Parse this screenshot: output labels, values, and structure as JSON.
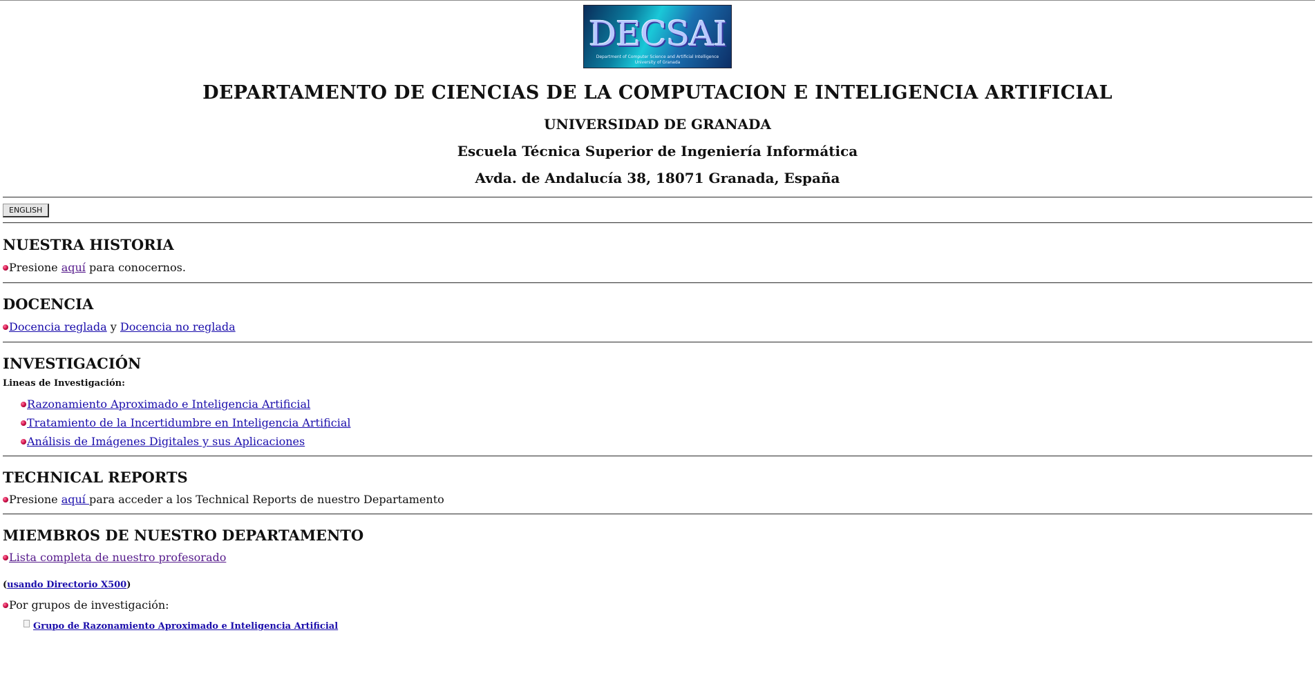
{
  "header": {
    "logo": {
      "word": "DECSAI",
      "sub1": "Department of Computer Science and Artificial Intelligence",
      "sub2": "University of Granada"
    },
    "title": "DEPARTAMENTO DE CIENCIAS DE LA COMPUTACION E INTELIGENCIA ARTIFICIAL",
    "university": "UNIVERSIDAD DE GRANADA",
    "school": "Escuela Técnica Superior de Ingeniería Informática",
    "address": "Avda. de Andalucía 38, 18071 Granada, España"
  },
  "lang_button": "ENGLISH",
  "historia": {
    "heading": "NUESTRA HISTORIA",
    "pre": "Presione",
    "link": "aquí",
    "post": " para conocernos."
  },
  "docencia": {
    "heading": "DOCENCIA",
    "link1": "Docencia reglada",
    "mid": " y ",
    "link2": "Docencia no reglada"
  },
  "investigacion": {
    "heading": "INVESTIGACIÓN",
    "label": "Lineas de Investigación:",
    "items": [
      "Razonamiento Aproximado e Inteligencia Artificial",
      "Tratamiento de la Incertidumbre en Inteligencia Artificial",
      "Análisis de Imágenes Digitales y sus Aplicaciones"
    ]
  },
  "reports": {
    "heading": "TECHNICAL REPORTS",
    "pre": "Presione",
    "link": "aquí ",
    "post": "para acceder a los Technical Reports de nuestro Departamento"
  },
  "miembros": {
    "heading": "MIEMBROS DE NUESTRO DEPARTAMENTO",
    "lista": "Lista completa de nuestro profesorado",
    "x500_open": "(",
    "x500": "usando Directorio X500",
    "x500_close": ")",
    "grupos_label": "Por grupos de investigación:",
    "grupo1": "Grupo de Razonamiento Aproximado e Inteligencia Artificial"
  }
}
